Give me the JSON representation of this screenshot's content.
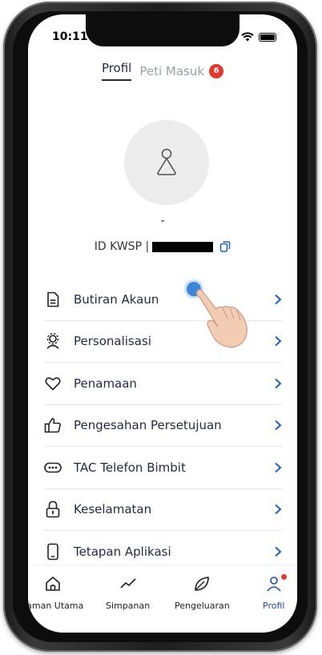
{
  "status_bar": {
    "time": "10:11"
  },
  "tabs": {
    "profile": "Profil",
    "inbox": "Peti Masuk",
    "inbox_count": "6"
  },
  "profile": {
    "name": "-",
    "id_prefix": "ID KWSP |"
  },
  "menu": [
    {
      "label": "Butiran Akaun",
      "icon": "document-icon"
    },
    {
      "label": "Personalisasi",
      "icon": "person-settings-icon"
    },
    {
      "label": "Penamaan",
      "icon": "heart-icon"
    },
    {
      "label": "Pengesahan Persetujuan",
      "icon": "thumbs-up-icon"
    },
    {
      "label": "TAC Telefon Bimbit",
      "icon": "dots-pill-icon"
    },
    {
      "label": "Keselamatan",
      "icon": "lock-icon"
    },
    {
      "label": "Tetapan Aplikasi",
      "icon": "phone-icon"
    }
  ],
  "bottom_nav": {
    "home": "Laman Utama",
    "savings": "Simpanan",
    "expenses": "Pengeluaran",
    "profile": "Profil"
  },
  "colors": {
    "accent": "#1b4ba0",
    "badge": "#e4382c",
    "chevron": "#1b5fc4"
  }
}
